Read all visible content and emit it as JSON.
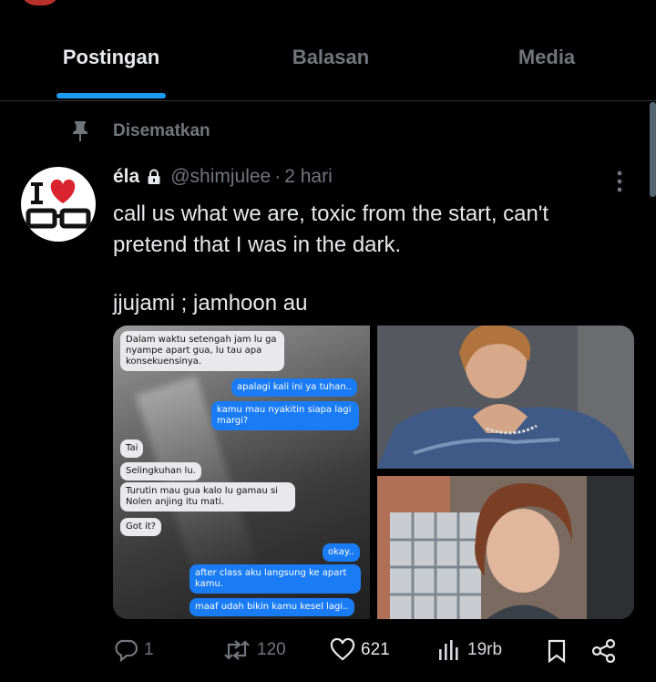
{
  "tabs": [
    {
      "label": "Postingan",
      "active": true
    },
    {
      "label": "Balasan",
      "active": false
    },
    {
      "label": "Media",
      "active": false
    }
  ],
  "pinned": {
    "label": "Disematkan",
    "icon": "pin-icon"
  },
  "tweet": {
    "display_name": "éla",
    "handle": "@shimjulee",
    "separator": "·",
    "time": "2 hari",
    "text_lines": [
      "call us what we are, toxic from the start, can't",
      "pretend that I was in the dark.",
      "jjujami ; jamhoon au"
    ],
    "chat_bubbles": [
      {
        "side": "in",
        "text": "Dalam waktu setengah jam lu ga\nnyampe apart gua, lu tau apa\nkonsekuensinya."
      },
      {
        "side": "out",
        "text": "apalagi kali ini ya tuhan.."
      },
      {
        "side": "out",
        "text": "kamu mau nyakitin siapa lagi\nmargi?"
      },
      {
        "side": "in",
        "text": "Tai"
      },
      {
        "side": "in",
        "text": "Selingkuhan lu."
      },
      {
        "side": "in",
        "text": "Turutin mau gua kalo lu gamau si\nNolen anjing itu mati."
      },
      {
        "side": "in",
        "text": "Got it?"
      },
      {
        "side": "out",
        "text": "okay.."
      },
      {
        "side": "out",
        "text": "after class aku langsung ke apart\nkamu."
      },
      {
        "side": "out",
        "text": "maaf udah bikin kamu kesel lagi.."
      }
    ],
    "stats": {
      "replies": "1",
      "reposts": "120",
      "likes": "621",
      "views": "19rb"
    }
  },
  "colors": {
    "accent": "#1d9bf0",
    "muted": "#71767b",
    "text": "#e7e9ea",
    "background": "#000000"
  }
}
